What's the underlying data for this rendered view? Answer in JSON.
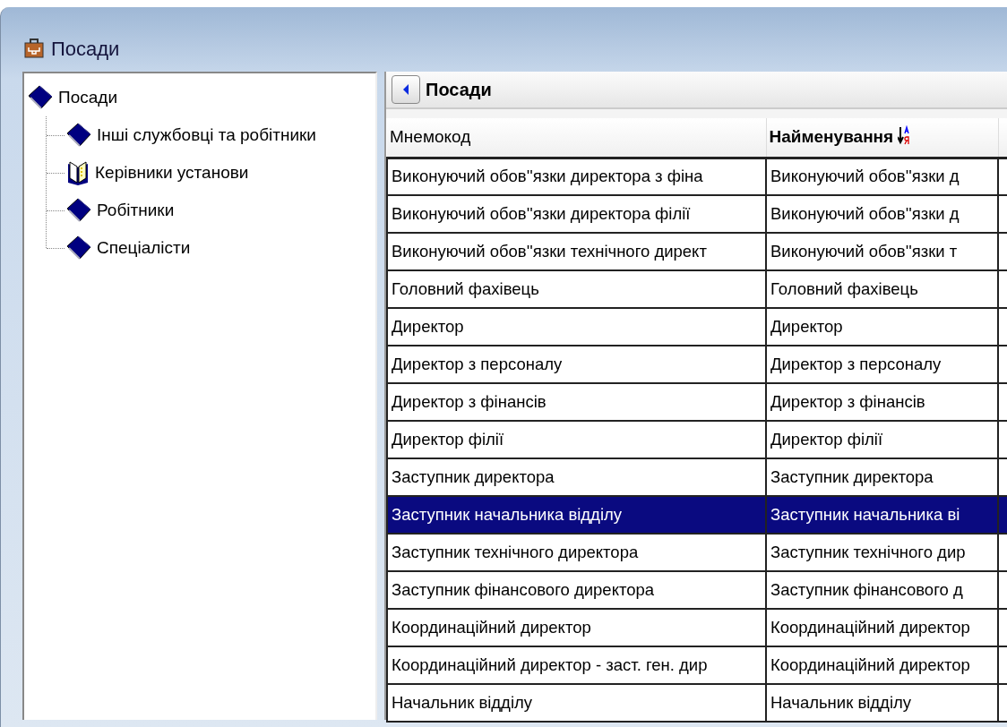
{
  "window": {
    "title": "Посади"
  },
  "tree": {
    "label": "Посади",
    "kind": "book",
    "children": [
      {
        "label": "Інші службовці та робітники",
        "kind": "book"
      },
      {
        "label": "Керівники установи",
        "kind": "open_book"
      },
      {
        "label": "Робітники",
        "kind": "book"
      },
      {
        "label": "Спеціалісти",
        "kind": "book"
      }
    ]
  },
  "grid": {
    "title": "Посади",
    "columns": [
      {
        "label": "Мнемокод",
        "sorted": false
      },
      {
        "label": "Найменування",
        "sorted": true
      }
    ],
    "rows": [
      {
        "cells": [
          "Виконуючий обов''язки директора з фіна",
          "Виконуючий обов''язки д"
        ],
        "selected": false
      },
      {
        "cells": [
          "Виконуючий обов''язки директора філії",
          "Виконуючий обов''язки д"
        ],
        "selected": false
      },
      {
        "cells": [
          "Виконуючий обов''язки технічного директ",
          "Виконуючий обов''язки т"
        ],
        "selected": false
      },
      {
        "cells": [
          "Головний фахівець",
          "Головний фахівець"
        ],
        "selected": false
      },
      {
        "cells": [
          "Директор",
          "Директор"
        ],
        "selected": false
      },
      {
        "cells": [
          "Директор з персоналу",
          "Директор з персоналу"
        ],
        "selected": false
      },
      {
        "cells": [
          "Директор з фінансів",
          "Директор з фінансів"
        ],
        "selected": false
      },
      {
        "cells": [
          "Директор філії",
          "Директор філії"
        ],
        "selected": false
      },
      {
        "cells": [
          "Заступник директора",
          "Заступник директора"
        ],
        "selected": false
      },
      {
        "cells": [
          "Заступник начальника відділу",
          "Заступник начальника ві"
        ],
        "selected": true
      },
      {
        "cells": [
          "Заступник технічного директора",
          "Заступник технічного дир"
        ],
        "selected": false
      },
      {
        "cells": [
          "Заступник фінансового директора",
          "Заступник фінансового д"
        ],
        "selected": false
      },
      {
        "cells": [
          "Координаційний директор",
          "Координаційний директор"
        ],
        "selected": false
      },
      {
        "cells": [
          "Координаційний директор - заст. ген. дир",
          "Координаційний директор"
        ],
        "selected": false
      },
      {
        "cells": [
          "Начальник відділу",
          "Начальник відділу"
        ],
        "selected": false
      }
    ]
  }
}
